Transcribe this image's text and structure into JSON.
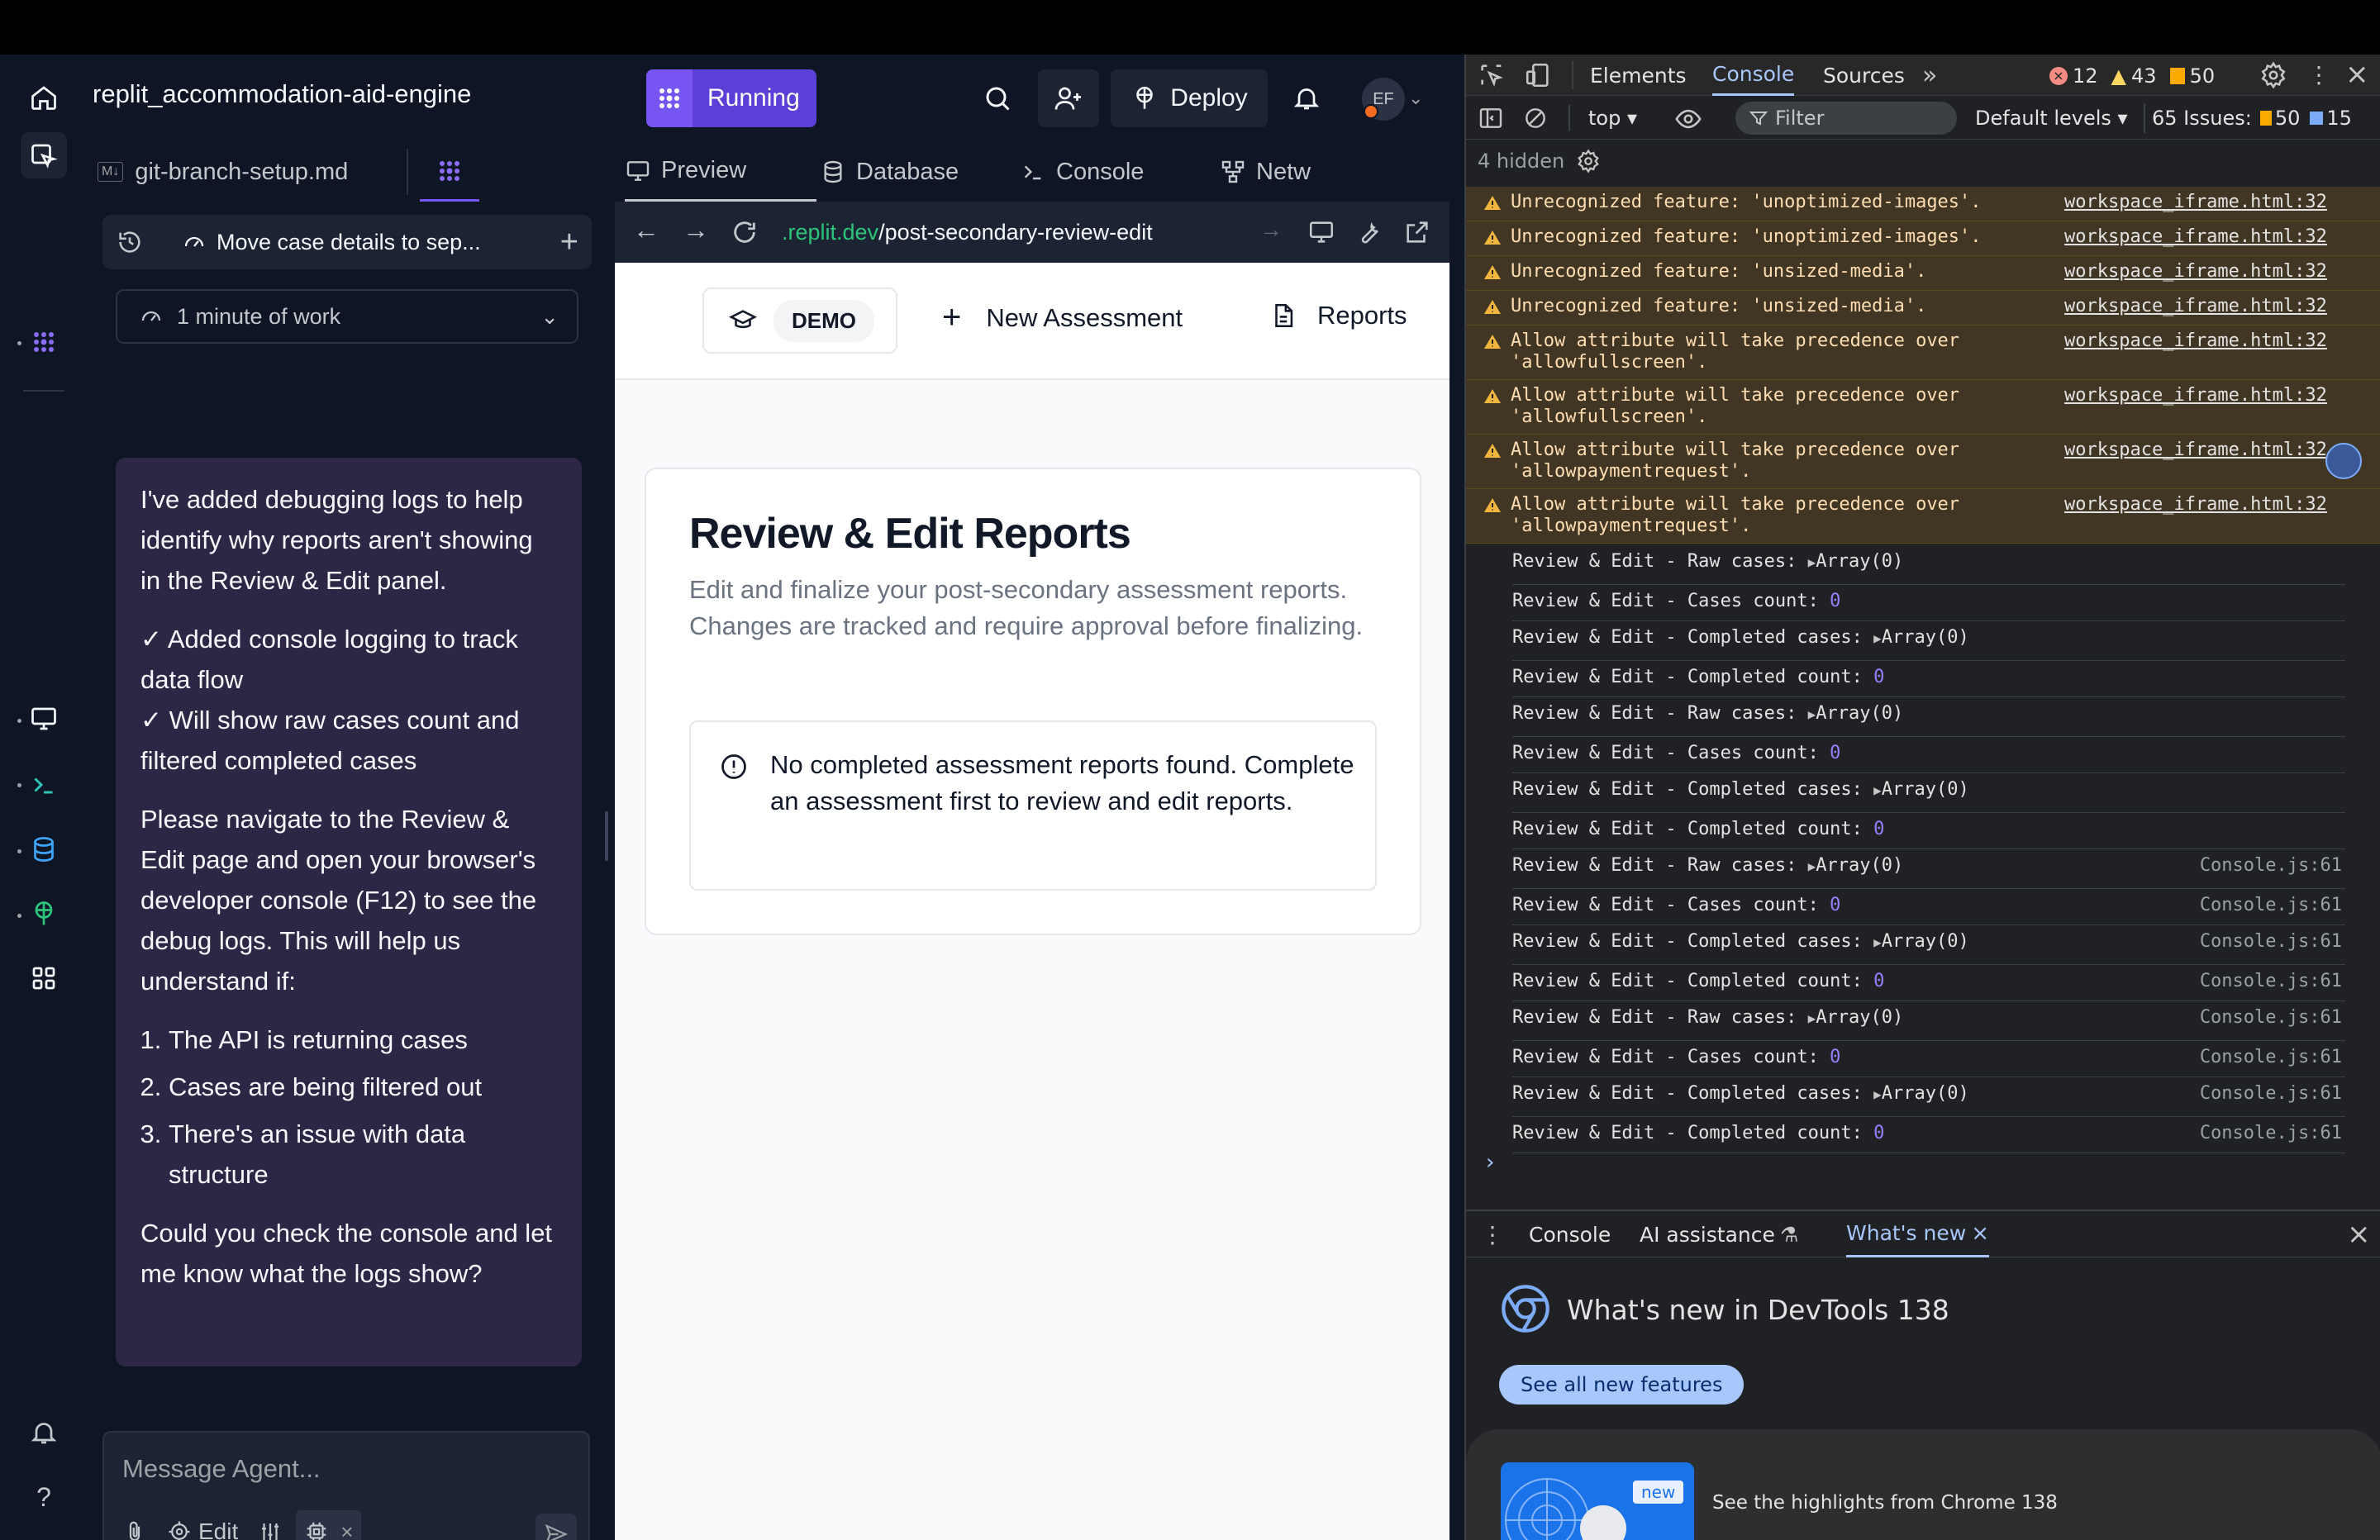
{
  "app": {
    "project_title": "replit_accommodation-aid-engine",
    "run_button_label": "Running",
    "deploy_label": "Deploy",
    "avatar_initials": "EF",
    "accent": "#7655f2"
  },
  "chat": {
    "file_tab_label": "git-branch-setup.md",
    "file_tab_badge": "M↓",
    "session_title": "Move case details to sep...",
    "work_label": "1 minute of work",
    "message": {
      "intro": "I've added debugging logs to help identify why reports aren't showing in the Review & Edit panel.",
      "check1": "✓ Added console logging to track data flow",
      "check2": "✓ Will show raw cases count and filtered completed cases",
      "instruction": "Please navigate to the Review & Edit page and open your browser's developer console (F12) to see the debug logs. This will help us understand if:",
      "list": [
        "The API is returning cases",
        "Cases are being filtered out",
        "There's an issue with data structure"
      ],
      "closing": "Could you check the console and let me know what the logs show?"
    },
    "input_placeholder": "Message Agent...",
    "edit_label": "Edit"
  },
  "preview": {
    "tabs": [
      "Preview",
      "Database",
      "Console",
      "Netw"
    ],
    "url_domain": ".replit.dev",
    "url_path": "/post-secondary-review-edit",
    "nav": {
      "demo_badge": "DEMO",
      "new_assessment": "New Assessment",
      "reports": "Reports"
    },
    "card": {
      "title": "Review & Edit Reports",
      "description": "Edit and finalize your post-secondary assessment reports. Changes are tracked and require approval before finalizing.",
      "alert": "No completed assessment reports found. Complete an assessment first to review and edit reports."
    }
  },
  "devtools": {
    "tabs": [
      "Elements",
      "Console",
      "Sources"
    ],
    "counts": {
      "errors": "12",
      "warnings": "43",
      "issues_flag": "50"
    },
    "context": "top",
    "filter_placeholder": "Filter",
    "levels": "Default levels",
    "issues_label": "65 Issues:",
    "issues_a": "50",
    "issues_b": "15",
    "hidden": "4 hidden",
    "warnings": [
      {
        "line1": "Unrecognized feature: 'unoptimized-images'.",
        "line2": "",
        "src": "workspace_iframe.html:32"
      },
      {
        "line1": "Unrecognized feature: 'unoptimized-images'.",
        "line2": "",
        "src": "workspace_iframe.html:32"
      },
      {
        "line1": "Unrecognized feature: 'unsized-media'.",
        "line2": "",
        "src": "workspace_iframe.html:32"
      },
      {
        "line1": "Unrecognized feature: 'unsized-media'.",
        "line2": "",
        "src": "workspace_iframe.html:32"
      },
      {
        "line1": "Allow attribute will take precedence over",
        "line2": "'allowfullscreen'.",
        "src": "workspace_iframe.html:32"
      },
      {
        "line1": "Allow attribute will take precedence over",
        "line2": "'allowfullscreen'.",
        "src": "workspace_iframe.html:32"
      },
      {
        "line1": "Allow attribute will take precedence over",
        "line2": "'allowpaymentrequest'.",
        "src": "workspace_iframe.html:32"
      },
      {
        "line1": "Allow attribute will take precedence over",
        "line2": "'allowpaymentrequest'.",
        "src": "workspace_iframe.html:32"
      }
    ],
    "logs": [
      {
        "text": "Review & Edit - Raw cases:",
        "value": "Array(0)",
        "num": "",
        "src": ""
      },
      {
        "text": "Review & Edit - Cases count:",
        "value": "",
        "num": "0",
        "src": ""
      },
      {
        "text": "Review & Edit - Completed cases:",
        "value": "Array(0)",
        "num": "",
        "src": ""
      },
      {
        "text": "Review & Edit - Completed count:",
        "value": "",
        "num": "0",
        "src": ""
      },
      {
        "text": "Review & Edit - Raw cases:",
        "value": "Array(0)",
        "num": "",
        "src": ""
      },
      {
        "text": "Review & Edit - Cases count:",
        "value": "",
        "num": "0",
        "src": ""
      },
      {
        "text": "Review & Edit - Completed cases:",
        "value": "Array(0)",
        "num": "",
        "src": ""
      },
      {
        "text": "Review & Edit - Completed count:",
        "value": "",
        "num": "0",
        "src": ""
      },
      {
        "text": "Review & Edit - Raw cases:",
        "value": "Array(0)",
        "num": "",
        "src": "Console.js:61"
      },
      {
        "text": "Review & Edit - Cases count:",
        "value": "",
        "num": "0",
        "src": "Console.js:61"
      },
      {
        "text": "Review & Edit - Completed cases:",
        "value": "Array(0)",
        "num": "",
        "src": "Console.js:61"
      },
      {
        "text": "Review & Edit - Completed count:",
        "value": "",
        "num": "0",
        "src": "Console.js:61"
      },
      {
        "text": "Review & Edit - Raw cases:",
        "value": "Array(0)",
        "num": "",
        "src": "Console.js:61"
      },
      {
        "text": "Review & Edit - Cases count:",
        "value": "",
        "num": "0",
        "src": "Console.js:61"
      },
      {
        "text": "Review & Edit - Completed cases:",
        "value": "Array(0)",
        "num": "",
        "src": "Console.js:61"
      },
      {
        "text": "Review & Edit - Completed count:",
        "value": "",
        "num": "0",
        "src": "Console.js:61"
      }
    ],
    "drawer": {
      "tabs": [
        "Console",
        "AI assistance",
        "What's new"
      ],
      "heading": "What's new in DevTools 138",
      "button": "See all new features",
      "new_badge": "new",
      "highlight": "See the highlights from Chrome 138"
    }
  }
}
